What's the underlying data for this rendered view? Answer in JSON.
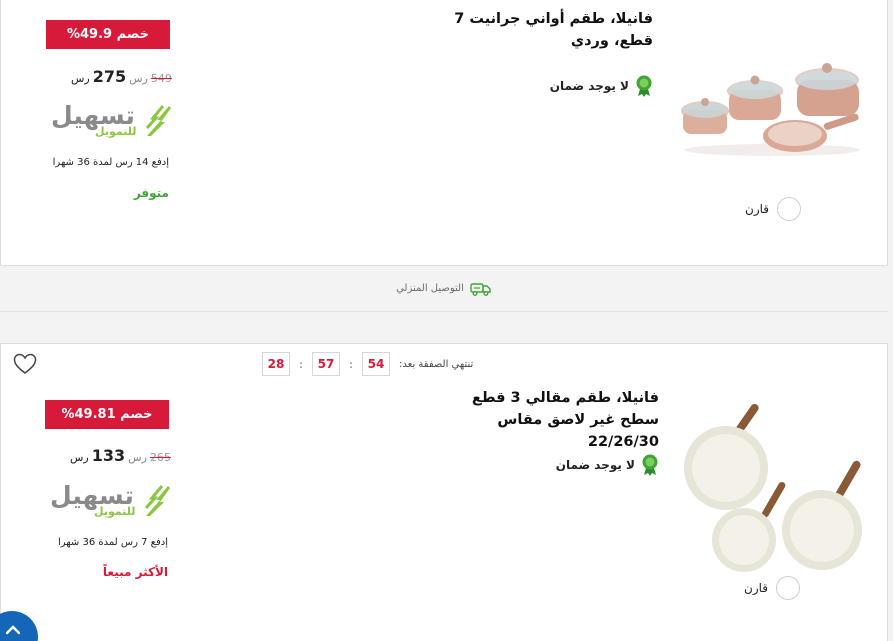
{
  "products": [
    {
      "title": "فانيلا، طقم أواني جرانيت 7 قطع، وردي",
      "warranty": "لا يوجد ضمان",
      "discount": "%49.9 خصم",
      "old_price": "549",
      "old_currency": "رس",
      "new_price": "275",
      "new_currency": "رس",
      "tasheel_main": "تسهيل",
      "tasheel_sub": "للتمويل",
      "installment": "إدفع 14 رس لمدة 36 شهرا",
      "stock_status": "متوفر",
      "stock_color": "#3fa535",
      "compare_label": "قارن",
      "image_icon": "cookware-set-icon"
    },
    {
      "title": "فانيلا، طقم مقالي 3 قطع سطح غير لاصق مقاس 22/26/30",
      "warranty": "لا يوجد ضمان",
      "discount": "%49.81 خصم",
      "old_price": "265",
      "old_currency": "رس",
      "new_price": "133",
      "new_currency": "رس",
      "tasheel_main": "تسهيل",
      "tasheel_sub": "للتمويل",
      "installment": "إدفع 7 رس لمدة 36 شهرا",
      "stock_status": "الأكثر مبيعاً",
      "stock_color": "#d7193a",
      "compare_label": "قارن",
      "image_icon": "frying-pans-icon"
    }
  ],
  "delivery": {
    "label": "التوصيل المنزلي",
    "icon": "delivery-truck-icon"
  },
  "countdown": {
    "label": "تنتهي الصفقة بعد:",
    "values": [
      "28",
      "57",
      "54"
    ],
    "separator": ":"
  },
  "colors": {
    "discount": "#d7193a",
    "warranty_badge": "#3fa535",
    "accent_blue": "#1466b8"
  }
}
